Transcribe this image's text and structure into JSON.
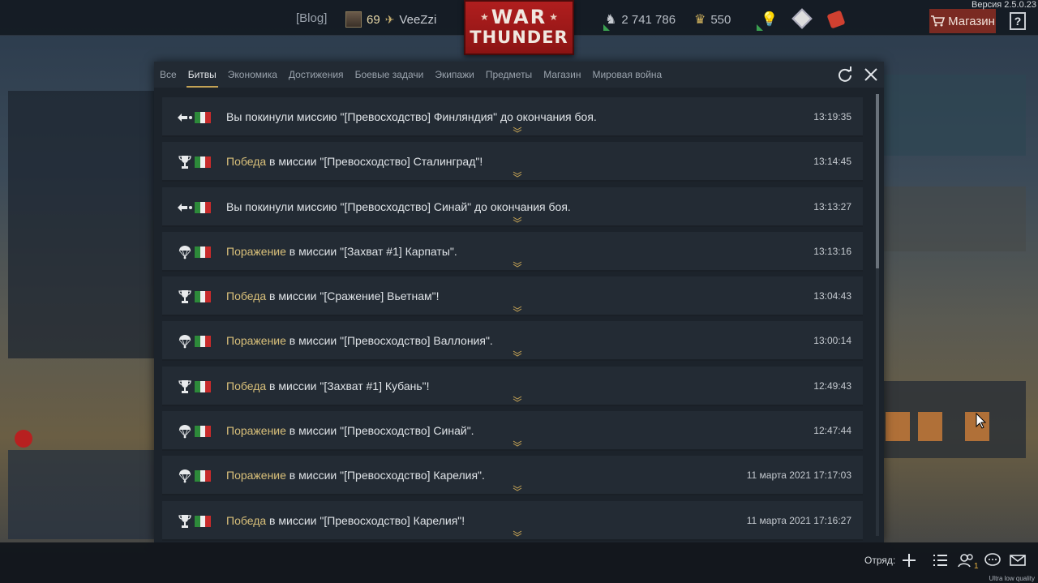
{
  "top": {
    "blog": "[Blog]",
    "level": "69",
    "nickname": "VeeZzi",
    "logo_line1": "WAR",
    "logo_line2": "THUNDER",
    "silver_lions": "2 741 786",
    "golden_eagles": "550",
    "shop": "Магазин",
    "help": "?",
    "version": "Версия 2.5.0.23"
  },
  "tabs": [
    {
      "label": "Все"
    },
    {
      "label": "Битвы",
      "active": true
    },
    {
      "label": "Экономика"
    },
    {
      "label": "Достижения"
    },
    {
      "label": "Боевые задачи"
    },
    {
      "label": "Экипажи"
    },
    {
      "label": "Предметы"
    },
    {
      "label": "Магазин"
    },
    {
      "label": "Мировая война"
    }
  ],
  "rows": [
    {
      "icon": "leave",
      "result": "",
      "text": "Вы покинули миссию \"[Превосходство] Финляндия\" до окончания боя.",
      "time": "13:19:35"
    },
    {
      "icon": "trophy",
      "result": "Победа",
      "text": " в миссии \"[Превосходство] Сталинград\"!",
      "time": "13:14:45"
    },
    {
      "icon": "leave",
      "result": "",
      "text": "Вы покинули миссию \"[Превосходство] Синай\" до окончания боя.",
      "time": "13:13:27"
    },
    {
      "icon": "parachute",
      "result": "Поражение",
      "text": " в миссии \"[Захват #1] Карпаты\".",
      "time": "13:13:16"
    },
    {
      "icon": "trophy",
      "result": "Победа",
      "text": " в миссии \"[Сражение] Вьетнам\"!",
      "time": "13:04:43"
    },
    {
      "icon": "parachute",
      "result": "Поражение",
      "text": " в миссии \"[Превосходство] Валлония\".",
      "time": "13:00:14"
    },
    {
      "icon": "trophy",
      "result": "Победа",
      "text": " в миссии \"[Захват #1] Кубань\"!",
      "time": "12:49:43"
    },
    {
      "icon": "parachute",
      "result": "Поражение",
      "text": " в миссии \"[Превосходство] Синай\".",
      "time": "12:47:44"
    },
    {
      "icon": "parachute",
      "result": "Поражение",
      "text": " в миссии \"[Превосходство] Карелия\".",
      "time": "11 марта 2021 17:17:03"
    },
    {
      "icon": "trophy",
      "result": "Победа",
      "text": " в миссии \"[Превосходство] Карелия\"!",
      "time": "11 марта 2021 17:16:27"
    }
  ],
  "bottom": {
    "squad_label": "Отряд:",
    "notification_count": "1",
    "quality": "Ultra low quality"
  },
  "colors": {
    "accent": "#c3a255",
    "result_text": "#d9c07a",
    "shop_bg": "#7a2a22",
    "logo_red": "#b01e1e"
  }
}
